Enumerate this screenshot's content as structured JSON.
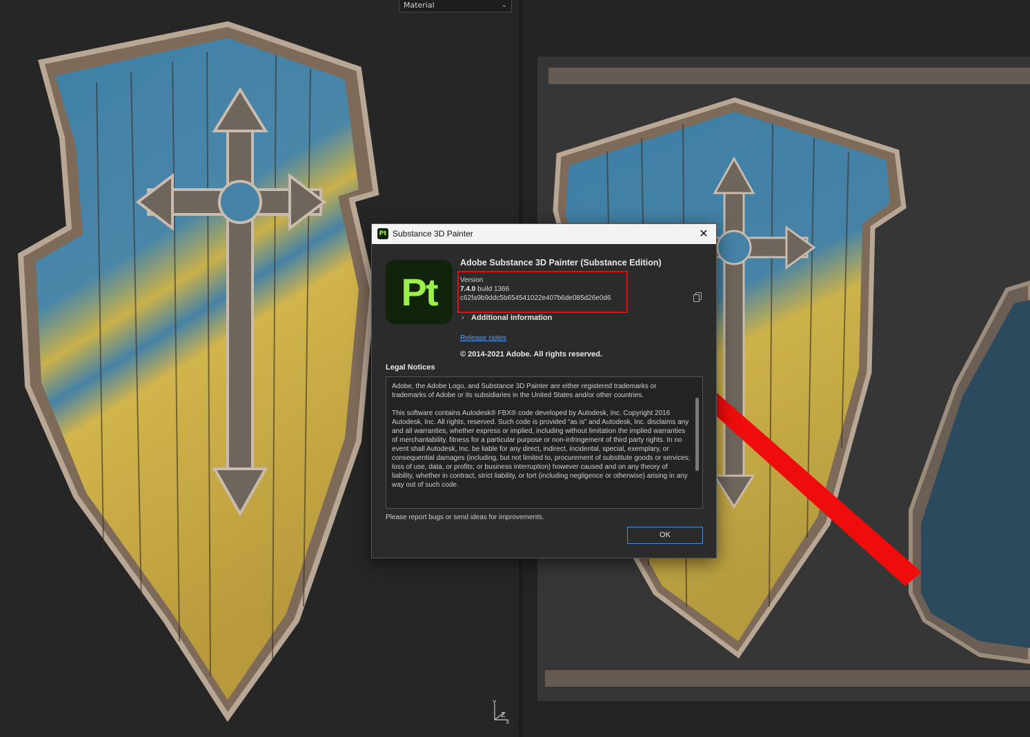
{
  "viewport": {
    "material_select": "Material",
    "axis_labels": {
      "y": "Y",
      "z": "Z",
      "x": "X"
    }
  },
  "dialog": {
    "window_title": "Substance 3D Painter",
    "app_logo_text": "Pt",
    "title_logo_text": "Pt",
    "product_name": "Adobe Substance 3D Painter (Substance Edition)",
    "version_label": "Version",
    "version_number": "7.4.0",
    "build_text": "build 1366",
    "version_hash": "c62fa9b9ddc5b654541022e407b6de085d26e0d6",
    "additional_info_label": "Additional information",
    "release_notes_link": "Release notes",
    "copyright": "© 2014-2021 Adobe. All rights reserved.",
    "legal_title": "Legal Notices",
    "legal_paragraphs": [
      "Adobe, the Adobe Logo, and Substance 3D Painter are either registered trademarks or trademarks of Adobe or its subsidiaries in the United States and/or other countries.",
      "This software contains Autodesk® FBX® code developed by Autodesk, Inc. Copyright 2016 Autodesk, Inc. All rights, reserved. Such code is provided “as is” and Autodesk, Inc. disclaims any and all warranties, whether express or implied, including without limitation the implied warranties of merchantability, fitness for a particular purpose or non-infringement of third party rights. In no event shall Autodesk, Inc. be liable for any direct, indirect, incidental, special, exemplary, or consequential damages (including, but not limited to, procurement of substitute goods or services; loss of use, data, or profits; or business interruption) however caused and on any theory of liability, whether in contract, strict liability, or tort (including negligence or otherwise) arising in any way out of such code."
    ],
    "report_text": "Please report bugs or send ideas for improvements.",
    "ok_label": "OK"
  },
  "colors": {
    "accent_blue": "#4a90e2",
    "highlight_red": "#e01010",
    "logo_green": "#9cf04a",
    "logo_bg": "#10240b"
  }
}
